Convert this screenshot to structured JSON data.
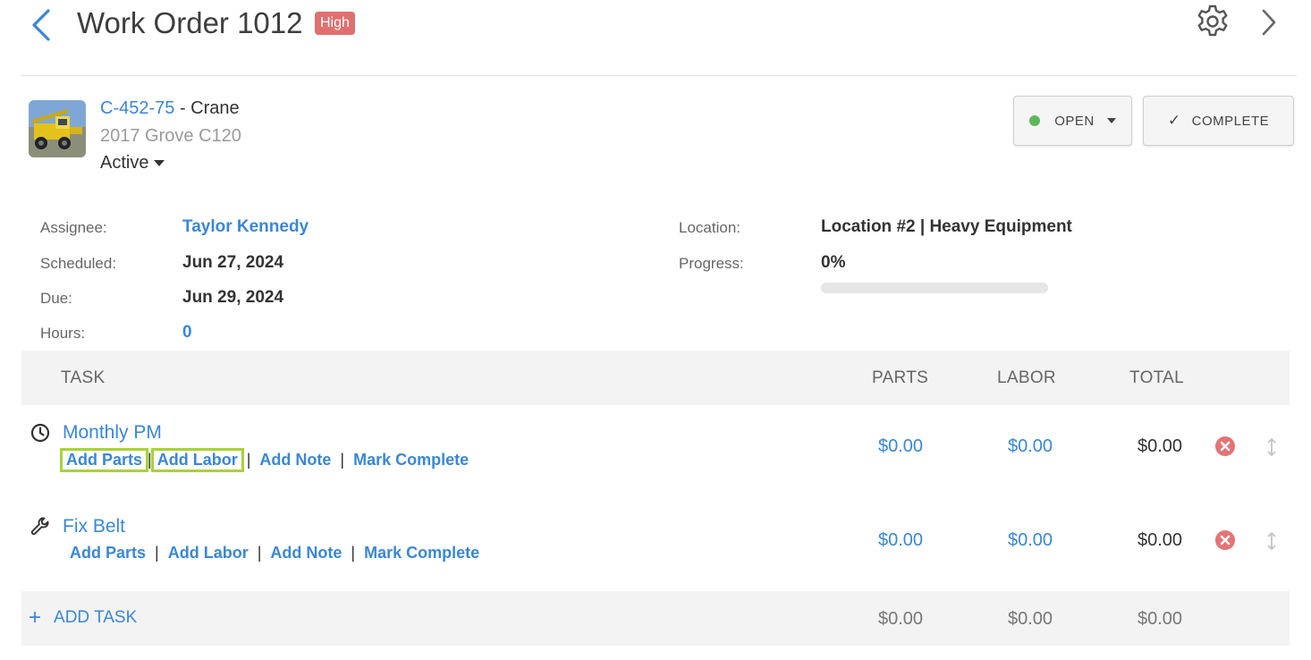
{
  "header": {
    "title": "Work Order 1012",
    "priority": "High"
  },
  "asset": {
    "code": "C-452-75",
    "separator": " - ",
    "type": "Crane",
    "model": "2017 Grove C120",
    "status": "Active"
  },
  "actions": {
    "status": "OPEN",
    "complete": "COMPLETE"
  },
  "details": {
    "assignee_label": "Assignee:",
    "assignee": "Taylor Kennedy",
    "scheduled_label": "Scheduled:",
    "scheduled": "Jun 27, 2024",
    "due_label": "Due:",
    "due": "Jun 29, 2024",
    "hours_label": "Hours:",
    "hours": "0",
    "location_label": "Location:",
    "location": "Location #2 | Heavy Equipment",
    "progress_label": "Progress:",
    "progress": "0%",
    "progress_fraction": 0
  },
  "table": {
    "headers": {
      "task": "TASK",
      "parts": "PARTS",
      "labor": "LABOR",
      "total": "TOTAL"
    },
    "tasks": [
      {
        "name": "Monthly PM",
        "icon": "clock-icon",
        "parts": "$0.00",
        "labor": "$0.00",
        "total": "$0.00",
        "actions": [
          "Add Parts",
          "Add Labor",
          "Add Note",
          "Mark Complete"
        ]
      },
      {
        "name": "Fix Belt",
        "icon": "wrench-icon",
        "parts": "$0.00",
        "labor": "$0.00",
        "total": "$0.00",
        "actions": [
          "Add Parts",
          "Add Labor",
          "Add Note",
          "Mark Complete"
        ]
      }
    ],
    "footer": {
      "add_task": "ADD TASK",
      "parts": "$0.00",
      "labor": "$0.00",
      "total": "$0.00"
    }
  },
  "colors": {
    "link": "#3a87d6",
    "priority_badge": "#e07070",
    "open_status": "#5cb85c",
    "remove": "#e57373",
    "highlight_outline": "#a9d13a"
  }
}
